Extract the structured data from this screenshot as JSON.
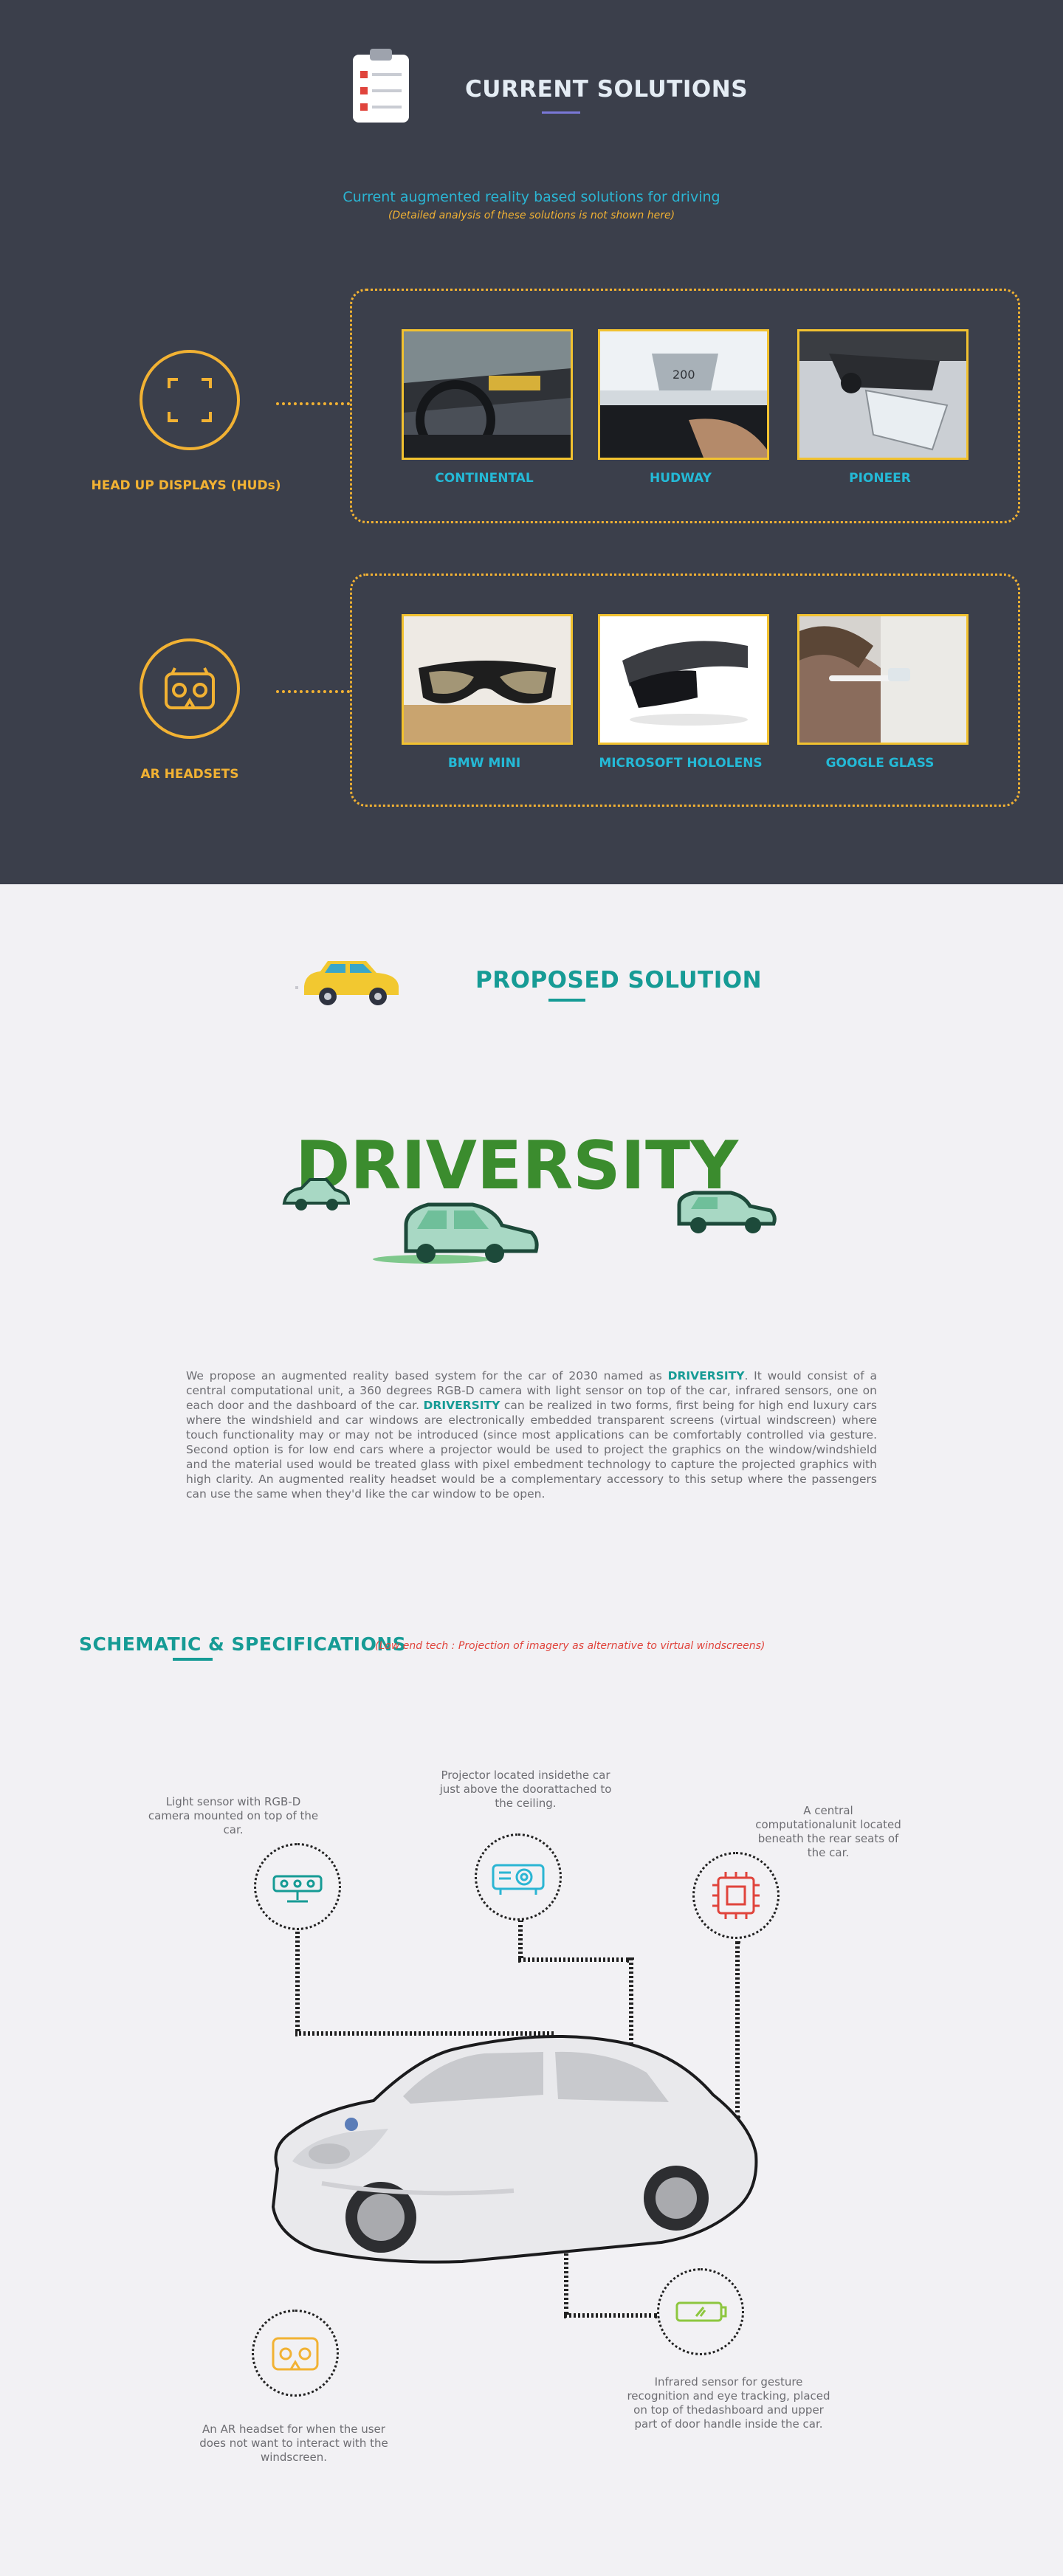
{
  "current_solutions": {
    "title": "CURRENT SOLUTIONS",
    "intro": "Current augmented reality based solutions for driving",
    "note": "(Detailed analysis of these solutions is not shown here)",
    "huds": {
      "label": "HEAD UP DISPLAYS (HUDs)",
      "items": [
        {
          "label": "CONTINENTAL"
        },
        {
          "label": "HUDWAY"
        },
        {
          "label": "PIONEER"
        }
      ]
    },
    "headsets": {
      "label": "AR HEADSETS",
      "items": [
        {
          "label": "BMW MINI"
        },
        {
          "label": "MICROSOFT HOLOLENS"
        },
        {
          "label": "GOOGLE GLASS"
        }
      ]
    }
  },
  "proposed": {
    "title": "PROPOSED SOLUTION",
    "logo_text": "DRIVERSITY",
    "paragraph": {
      "p1": "We propose an augmented reality based system for the car of 2030 named as ",
      "brand1": "DRIVERSITY",
      "p2": ". It would consist of a central computational unit, a 360 degrees RGB-D camera with light sensor on top of the car, infrared sensors, one on each door and the dashboard of the car. ",
      "brand2": "DRIVERSITY",
      "p3": " can be realized in two forms, first being for high end luxury cars where the windshield and car windows are electronically embedded transparent screens (virtual windscreen) where touch functionality may or may not be introduced (since most applications can be comfortably controlled via gesture. Second option is for low end cars where a projector would be used to project the graphics on the window/windshield and the material used would be treated glass with pixel embedment technology to capture the projected graphics with high clarity. An augmented reality headset would be a complementary accessory to this setup where the passengers can use the same when they'd like the car window to be open."
    }
  },
  "schematic": {
    "title": "SCHEMATIC & SPECIFICATIONS",
    "note": "(Low end tech : Projection of imagery as alternative to virtual windscreens)",
    "captions": {
      "camera": "Light sensor with RGB-D camera mounted on top of the car.",
      "projector": "Projector located insidethe car just above the doorattached to the ceiling.",
      "cpu": "A central computationalunit located beneath the rear seats of the car.",
      "headset": "An AR headset for when the user does not want to interact with the windscreen.",
      "infrared": "Infrared sensor for gesture recognition and eye tracking, placed on top of thedashboard and upper part of door handle inside the car."
    }
  },
  "colors": {
    "dark_bg": "#3b3f4b",
    "gold": "#f2b233",
    "cyan": "#24b9d6",
    "teal": "#169b95",
    "red": "#e0443c",
    "light_bg": "#f2f1f4"
  }
}
